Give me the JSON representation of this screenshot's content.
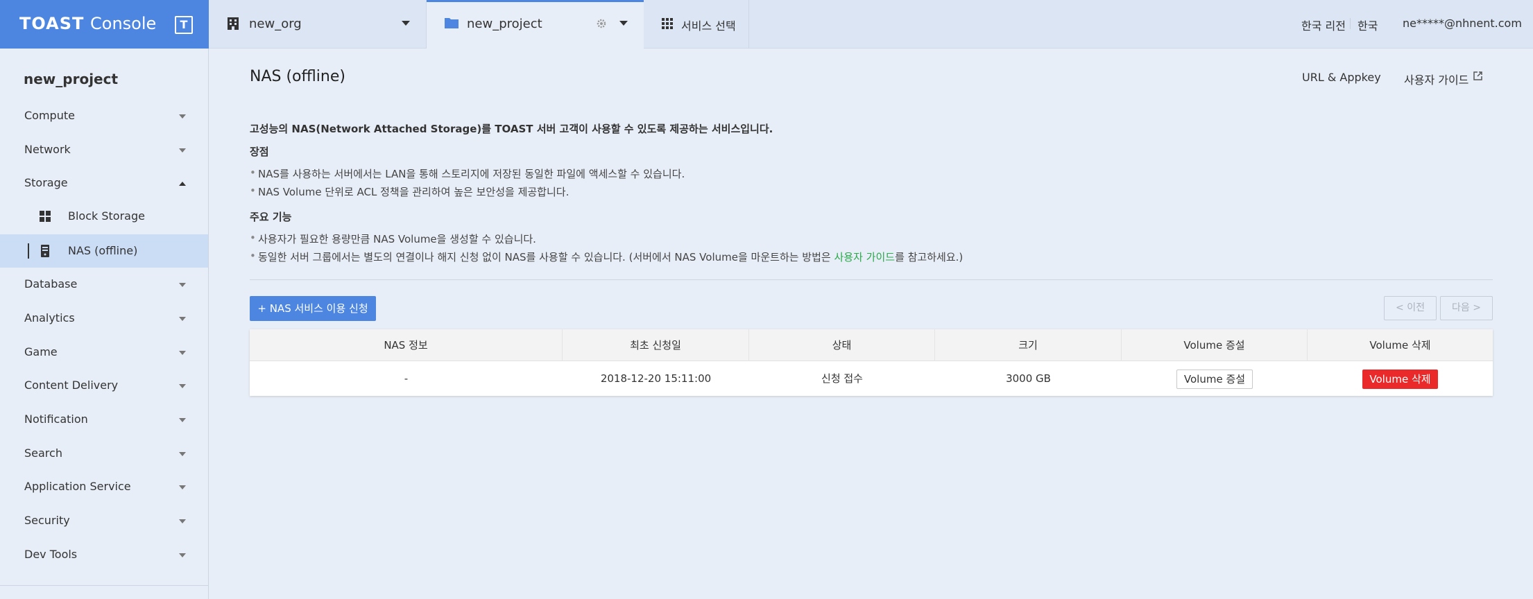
{
  "brand": {
    "logo": "TOAST",
    "console": "Console",
    "menu_glyph": "T"
  },
  "topbar": {
    "org_name": "new_org",
    "project_name": "new_project",
    "service_select": "서비스 선택",
    "region": "한국 리전",
    "language": "한국",
    "user_email": "ne*****@nhnent.com"
  },
  "sidebar": {
    "project_name": "new_project",
    "items": [
      {
        "label": "Compute"
      },
      {
        "label": "Network"
      },
      {
        "label": "Storage"
      },
      {
        "label": "Database"
      },
      {
        "label": "Analytics"
      },
      {
        "label": "Game"
      },
      {
        "label": "Content Delivery"
      },
      {
        "label": "Notification"
      },
      {
        "label": "Search"
      },
      {
        "label": "Application Service"
      },
      {
        "label": "Security"
      },
      {
        "label": "Dev Tools"
      }
    ],
    "storage_sub": [
      {
        "label": "Block Storage"
      },
      {
        "label": "NAS (offline)"
      }
    ]
  },
  "main": {
    "title": "NAS (offline)",
    "url_appkey": "URL & Appkey",
    "user_guide": "사용자 가이드",
    "intro": "고성능의 NAS(Network Attached Storage)를 TOAST 서버 고객이 사용할 수 있도록 제공하는 서비스입니다.",
    "advantages_title": "장점",
    "advantages": [
      "NAS를 사용하는 서버에서는 LAN을 통해 스토리지에 저장된 동일한 파일에 액세스할 수 있습니다.",
      "NAS Volume 단위로 ACL 정책을 관리하여 높은 보안성을 제공합니다."
    ],
    "features_title": "주요 기능",
    "feature1": "사용자가 필요한 용량만큼 NAS Volume을 생성할 수 있습니다.",
    "feature2_prefix": "동일한 서버 그룹에서는 별도의 연결이나 해지 신청 없이 NAS를 사용할 수 있습니다. (서버에서 NAS Volume을 마운트하는 방법은 ",
    "feature2_link": "사용자 가이드",
    "feature2_suffix": "를 참고하세요.)",
    "apply_button": "+ NAS 서비스 이용 신청",
    "prev_button": "< 이전",
    "next_button": "다음 >"
  },
  "table": {
    "headers": [
      "NAS 정보",
      "최초 신청일",
      "상태",
      "크기",
      "Volume 증설",
      "Volume 삭제"
    ],
    "row": {
      "nas_info": "-",
      "created": "2018-12-20 15:11:00",
      "status": "신청 접수",
      "size": "3000 GB",
      "inc_button": "Volume 증설",
      "del_button": "Volume 삭제"
    }
  },
  "colors": {
    "brand": "#4c86e0",
    "danger": "#ea2a2a",
    "link": "#2aa84a"
  }
}
